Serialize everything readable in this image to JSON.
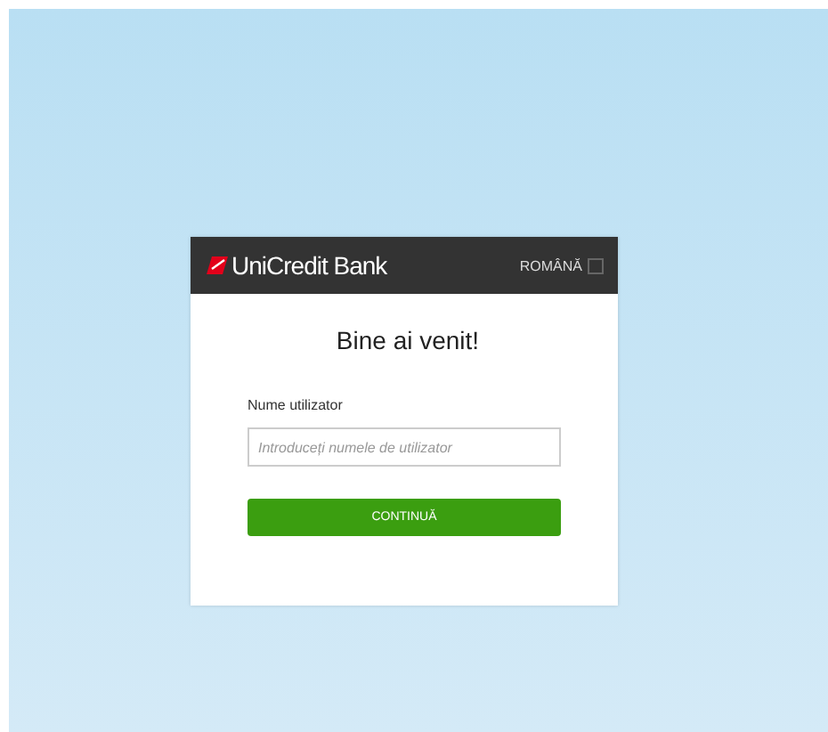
{
  "header": {
    "brand": "UniCredit Bank",
    "language": "ROMÂNĂ"
  },
  "title": "Bine ai venit!",
  "form": {
    "label": "Nume utilizator",
    "placeholder": "Introduceți numele de utilizator",
    "button": "CONTINUĂ"
  }
}
